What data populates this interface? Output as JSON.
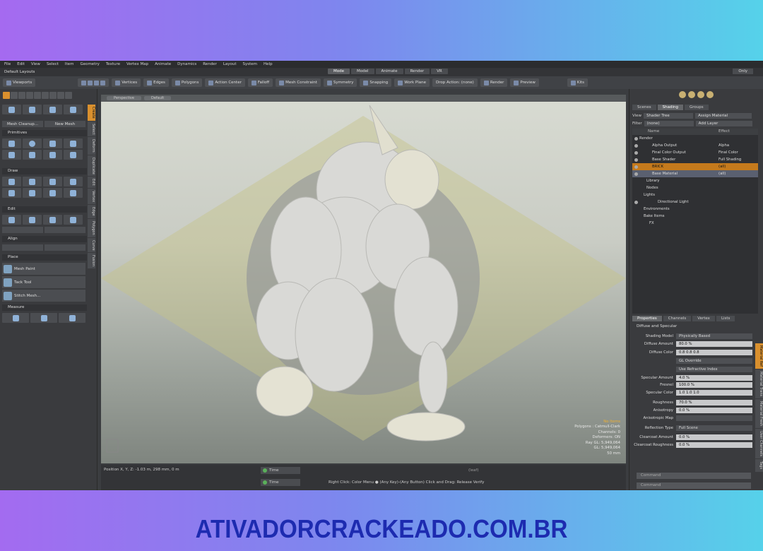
{
  "watermark": "ATIVADORCRACKEADO.COM.BR",
  "menu": [
    "File",
    "Edit",
    "View",
    "Select",
    "Item",
    "Geometry",
    "Texture",
    "Vertex Map",
    "Animate",
    "Dynamics",
    "Render",
    "Layout",
    "System",
    "Help"
  ],
  "layout_label": "Default Layouts",
  "layout_tabs": [
    "Mode",
    "Model",
    "Animate",
    "Render",
    "VR"
  ],
  "only_label": "Only",
  "toolbar": {
    "viewports": "Viewports",
    "vertices": "Vertices",
    "edges": "Edges",
    "polygons": "Polygons",
    "action_center": "Action Center",
    "falloff": "Falloff",
    "mesh_constraint": "Mesh Constraint",
    "symmetry": "Symmetry",
    "snapping": "Snapping",
    "work_plane": "Work Plane",
    "drop_action": "Drop Action: (none)",
    "render": "Render",
    "preview": "Preview",
    "kits": "Kits"
  },
  "left": {
    "mesh_cleanup": "Mesh Cleanup...",
    "new_mesh": "New Mesh",
    "primitives": "Primitives",
    "draw": "Draw",
    "edit": "Edit",
    "align": "Align",
    "place": "Place",
    "mesh_paint": "Mesh Paint",
    "tack_tool": "Tack Tool",
    "stitch_mesh": "Stitch Mesh...",
    "measure": "Measure",
    "vtabs": [
      "Create",
      "Select",
      "Deform",
      "Duplicate",
      "Edit",
      "Vertex",
      "Edge",
      "Polygon",
      "Curve",
      "Fusion"
    ]
  },
  "viewport": {
    "view_mode": "Perspective",
    "shading": "Default",
    "info": [
      "No Items",
      "Polygons : Catmull-Clark",
      "Channels: 0",
      "Deformers: ON",
      "Ray GL: 5,949,064",
      "GL: 5,949,064",
      "50 mm"
    ]
  },
  "status": {
    "position": "Position X, Y, Z:   -1.03 m, 298 mm, 0 m",
    "time1": "Time",
    "time2": "Time",
    "hint": "Right Click: Color Menu ● (Any Key)-(Any Button) Click and Drag: Release Verify",
    "leaf": "(leaf)"
  },
  "right": {
    "tabs": [
      "Scenes",
      "Shading",
      "Groups"
    ],
    "view_label": "View",
    "view_value": "Shader Tree",
    "assign_material": "Assign Material",
    "filter_label": "Filter",
    "filter_value": "(none)",
    "add_layer": "Add Layer",
    "col_name": "Name",
    "col_effect": "Effect",
    "tree": [
      {
        "name": "Render",
        "effect": "",
        "indent": 10
      },
      {
        "name": "Alpha Output",
        "effect": "Alpha",
        "indent": 28
      },
      {
        "name": "Final Color Output",
        "effect": "Final Color",
        "indent": 28
      },
      {
        "name": "Base Shader",
        "effect": "Full Shading",
        "indent": 28
      },
      {
        "name": "BRICK",
        "effect": "(all)",
        "indent": 28,
        "sel": true
      },
      {
        "name": "Base Material",
        "effect": "(all)",
        "indent": 28,
        "sel2": true
      },
      {
        "name": "Library",
        "effect": "",
        "indent": 20
      },
      {
        "name": "Nodes",
        "effect": "",
        "indent": 20
      },
      {
        "name": "Lights",
        "effect": "",
        "indent": 16
      },
      {
        "name": "Directional Light",
        "effect": "",
        "indent": 36
      },
      {
        "name": "Environments",
        "effect": "",
        "indent": 16
      },
      {
        "name": "Bake Items",
        "effect": "",
        "indent": 16
      },
      {
        "name": "FX",
        "effect": "",
        "indent": 24
      }
    ],
    "prop_tabs": [
      "Properties",
      "Channels",
      "Vertex",
      "Lists"
    ],
    "section": "Diffuse and Specular",
    "props": [
      {
        "label": "Shading Model",
        "value": "Physically Based",
        "dark": true
      },
      {
        "label": "Diffuse Amount",
        "value": "80.0 %"
      },
      {
        "label": "Diffuse Color",
        "value": "0.8     0.8     0.8"
      },
      {
        "label": "",
        "value": "GL Override",
        "dark": true
      },
      {
        "label": "",
        "value": "Use Refractive Index",
        "dark": true
      },
      {
        "label": "Specular Amount",
        "value": "4.0 %"
      },
      {
        "label": "Fresnel",
        "value": "100.0 %"
      },
      {
        "label": "Specular Color",
        "value": "1.0     1.0     1.0"
      },
      {
        "label": "Roughness",
        "value": "70.0 %"
      },
      {
        "label": "Anisotropy",
        "value": "0.0 %"
      },
      {
        "label": "Anisotropic Map",
        "value": "",
        "dark": true
      },
      {
        "label": "Reflection Type",
        "value": "Full Scene",
        "dark": true
      },
      {
        "label": "Clearcoat Amount",
        "value": "0.0 %"
      },
      {
        "label": "Clearcoat Roughness",
        "value": "0.0 %"
      }
    ],
    "command1": "Command",
    "command2": "Command",
    "vtabs": [
      "Material Ref",
      "Material Trans",
      "Material Fresh",
      "User Channels",
      "Tags"
    ]
  }
}
